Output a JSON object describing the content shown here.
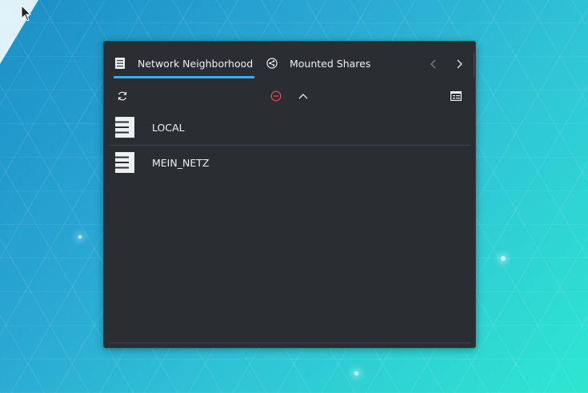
{
  "tabs": [
    {
      "label": "Network Neighborhood",
      "icon": "network-server-icon",
      "active": true
    },
    {
      "label": "Mounted Shares",
      "icon": "share-icon",
      "active": false
    }
  ],
  "toolbar": {
    "icons": [
      "refresh-icon",
      "abort-icon",
      "go-up-icon",
      "view-options-icon"
    ]
  },
  "items": [
    {
      "label": "LOCAL",
      "icon": "workgroup-server-icon"
    },
    {
      "label": "MEIN_NETZ",
      "icon": "workgroup-server-icon"
    }
  ],
  "colors": {
    "accent": "#3daee9",
    "abort": "#da4453",
    "panel": "#2a2e32",
    "text": "#eff0f1"
  }
}
